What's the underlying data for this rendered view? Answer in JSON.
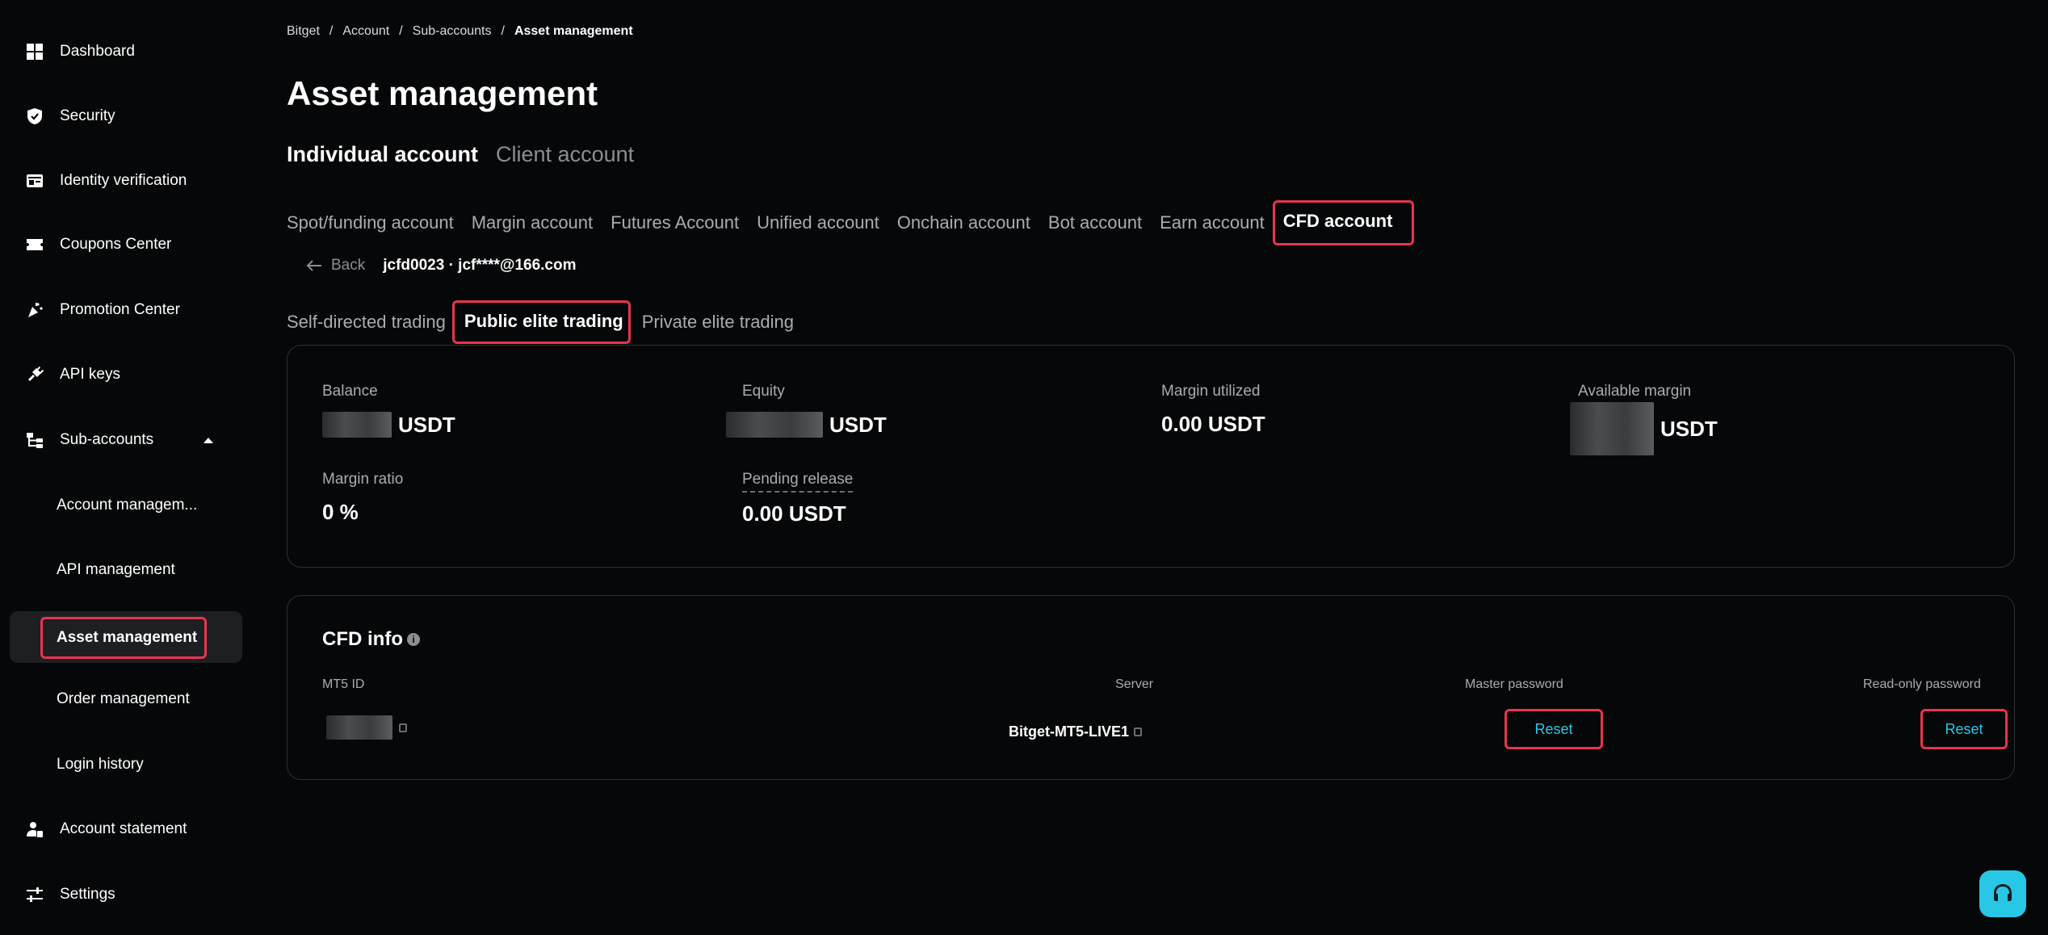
{
  "sidebar": {
    "items": [
      {
        "label": "Dashboard",
        "icon": "grid-icon"
      },
      {
        "label": "Security",
        "icon": "shield-icon"
      },
      {
        "label": "Identity verification",
        "icon": "id-card-icon"
      },
      {
        "label": "Coupons Center",
        "icon": "ticket-icon"
      },
      {
        "label": "Promotion Center",
        "icon": "party-popper-icon"
      },
      {
        "label": "API keys",
        "icon": "plug-icon"
      },
      {
        "label": "Sub-accounts",
        "icon": "hierarchy-icon"
      },
      {
        "label": "Account statement",
        "icon": "user-doc-icon"
      },
      {
        "label": "Settings",
        "icon": "sliders-icon"
      }
    ],
    "sub_items": [
      {
        "label": "Account managem..."
      },
      {
        "label": "API management"
      },
      {
        "label": "Asset management"
      },
      {
        "label": "Order management"
      },
      {
        "label": "Login history"
      }
    ]
  },
  "breadcrumb": {
    "items": [
      "Bitget",
      "Account",
      "Sub-accounts"
    ],
    "separator": "/",
    "current": "Asset management"
  },
  "page_title": "Asset management",
  "account_tabs": {
    "active": "Individual account",
    "inactive": "Client account"
  },
  "type_tabs": [
    "Spot/funding account",
    "Margin account",
    "Futures Account",
    "Unified account",
    "Onchain account",
    "Bot account",
    "Earn account",
    "CFD account"
  ],
  "back": {
    "label": "Back",
    "account_id": "jcfd0023 · jcf****@166.com"
  },
  "mode_tabs": {
    "left": "Self-directed trading",
    "active": "Public elite trading",
    "right": "Private elite trading"
  },
  "summary": {
    "balance": {
      "label": "Balance",
      "unit": "USDT"
    },
    "equity": {
      "label": "Equity",
      "unit": "USDT"
    },
    "margin_utilized": {
      "label": "Margin utilized",
      "value": "0.00 USDT"
    },
    "available_margin": {
      "label": "Available margin",
      "unit": "USDT"
    },
    "margin_ratio": {
      "label": "Margin ratio",
      "value": "0 %"
    },
    "pending_release": {
      "label": "Pending release",
      "value": "0.00 USDT"
    }
  },
  "cfd_info": {
    "title": "CFD info",
    "mt5_id_label": "MT5 ID",
    "server_label": "Server",
    "server_value": "Bitget-MT5-LIVE1",
    "master_password_label": "Master password",
    "readonly_password_label": "Read-only password",
    "reset_label": "Reset"
  },
  "colors": {
    "accent": "#28c7e6",
    "highlight": "#e8344f",
    "background": "#060708"
  }
}
